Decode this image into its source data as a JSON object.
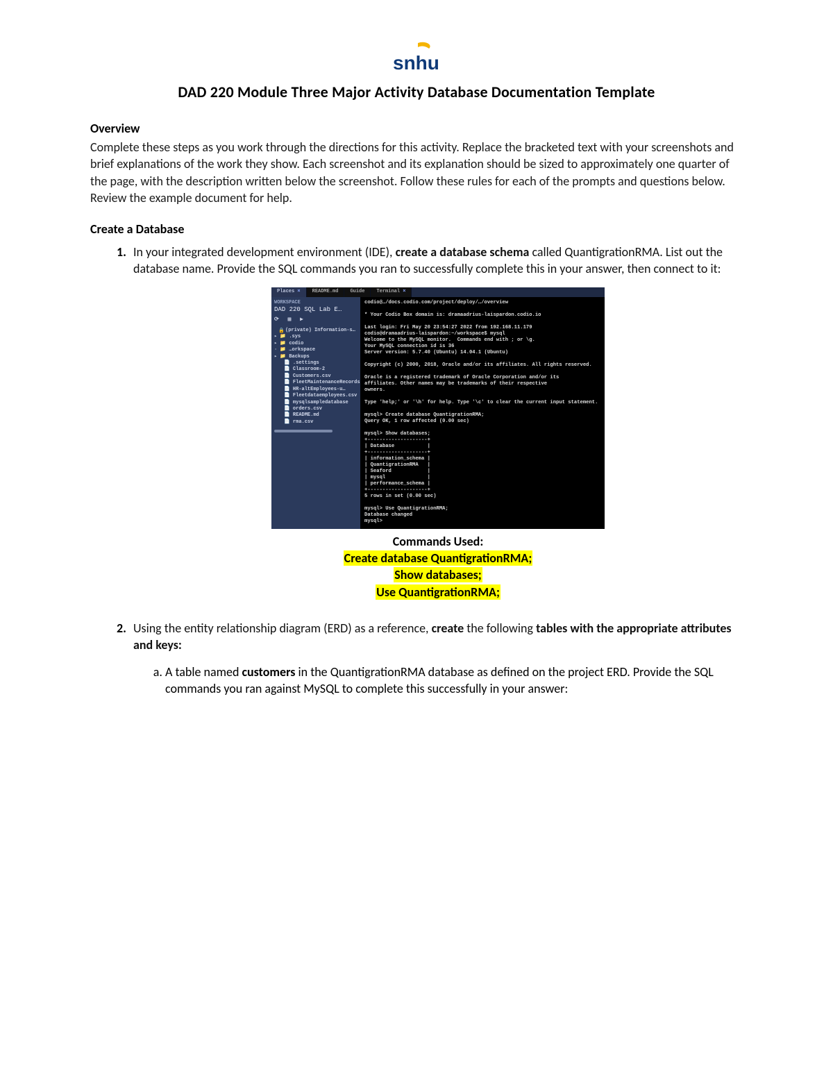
{
  "logo_text": "snhu",
  "title": "DAD 220 Module Three Major Activity Database Documentation Template",
  "overview": {
    "heading": "Overview",
    "body": "Complete these steps as you work through the directions for this activity. Replace the bracketed text with your screenshots and brief explanations of the work they show. Each screenshot and its explanation should be sized to approximately one quarter of the page, with the description written below the screenshot. Follow these rules for each of the prompts and questions below. Review the example document for help."
  },
  "create_db_heading": "Create a Database",
  "step1": {
    "pre": "In your integrated development environment (IDE), ",
    "bold": "create a database schema",
    "post": " called QuantigrationRMA. List out the database name. Provide the SQL commands you ran to successfully complete this in your answer, then connect to it:"
  },
  "ide": {
    "tabs": {
      "places": "Places",
      "readme": "README.md",
      "guide": "Guide",
      "terminal": "Terminal"
    },
    "sidebar": {
      "ws": "WORKSPACE",
      "project": "DAD 220 SQL Lab E…",
      "tree": [
        "  (private) Information-s…",
        "▸ 📁 .sys",
        "▸ 📁 codio",
        " · 📁 …orkspace",
        "▸ 📁 Backups",
        "   📄 .settings",
        "   📄 Classroom-2",
        "   📄 Customers.csv",
        "   📄 FleetMaintenanceRecords.c",
        "   📄 HR-altEmployees-u…",
        "   📄 Fleetdataemployees.csv",
        "   📄 mysqlsampledatabase",
        "   📄 orders.csv",
        "   📄 README.md",
        "   📄 rma.csv"
      ]
    },
    "terminal_lines": [
      "codio@…/docs.codio.com/project/deploy/…/overview",
      "",
      "* Your Codio Box domain is: dramaadrius-laispardon.codio.io",
      "",
      "Last login: Fri May 20 23:54:27 2022 from 192.168.11.179",
      "codio@dramaadrius-laispardon:~/workspace$ mysql",
      "Welcome to the MySQL monitor.  Commands end with ; or \\g.",
      "Your MySQL connection id is 36",
      "Server version: 5.7.40 (Ubuntu) 14.04.1 (Ubuntu)",
      "",
      "Copyright (c) 2000, 2018, Oracle and/or its affiliates. All rights reserved.",
      "",
      "Oracle is a registered trademark of Oracle Corporation and/or its",
      "affiliates. Other names may be trademarks of their respective",
      "owners.",
      "",
      "Type 'help;' or '\\h' for help. Type '\\c' to clear the current input statement.",
      "",
      "mysql> Create database QuantigrationRMA;",
      "Query OK, 1 row affected (0.00 sec)",
      "",
      "mysql> Show databases;",
      "+--------------------+",
      "| Database           |",
      "+--------------------+",
      "| information_schema |",
      "| QuantigrationRMA   |",
      "| Seaford            |",
      "| mysql              |",
      "| performance_schema |",
      "+--------------------+",
      "5 rows in set (0.00 sec)",
      "",
      "mysql> Use QuantigrationRMA;",
      "Database changed",
      "mysql> "
    ]
  },
  "commands": {
    "label": "Commands Used:",
    "l1": "Create database QuantigrationRMA;",
    "l2": "Show databases;",
    "l3": "Use QuantigrationRMA;"
  },
  "step2": {
    "pre": "Using the entity relationship diagram (ERD) as a reference, ",
    "bold1": "create",
    "mid": " the following ",
    "bold2": "tables with the appropriate attributes and keys:"
  },
  "step2a": {
    "pre": "A table named ",
    "bold": "customers",
    "post": " in the QuantigrationRMA database as defined on the project ERD. Provide the SQL commands you ran against MySQL to complete this successfully in your answer:"
  }
}
